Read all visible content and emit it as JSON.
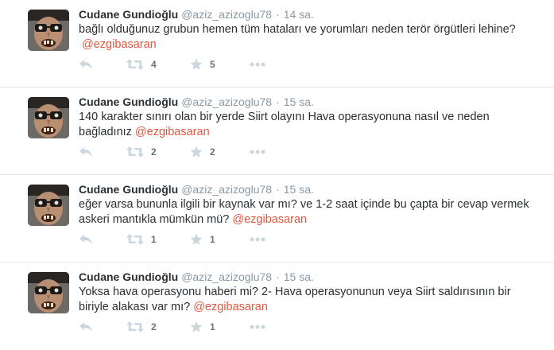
{
  "colors": {
    "mention": "#e0573f",
    "muted": "#8899a6",
    "icon": "#ccd6dd",
    "divider": "#e1e8ed"
  },
  "icons": {
    "reply": "reply-icon",
    "retweet": "retweet-icon",
    "favorite": "star-icon",
    "more": "more-icon"
  },
  "tweets": [
    {
      "fullname": "Cudane Gundioğlu",
      "username": "@aziz_azizoglu78",
      "separator": "·",
      "time": "14 sa.",
      "text": "bağlı olduğunuz grubun hemen tüm hataları ve yorumları neden terör örgütleri lehine?",
      "mention": "@ezgibasaran",
      "retweets": "4",
      "favorites": "5"
    },
    {
      "fullname": "Cudane Gundioğlu",
      "username": "@aziz_azizoglu78",
      "separator": "·",
      "time": "15 sa.",
      "text": "140 karakter sınırı olan bir yerde Siirt olayını Hava operasyonuna nasıl ve neden bağladınız",
      "mention": "@ezgibasaran",
      "retweets": "2",
      "favorites": "2"
    },
    {
      "fullname": "Cudane Gundioğlu",
      "username": "@aziz_azizoglu78",
      "separator": "·",
      "time": "15 sa.",
      "text": "eğer varsa bununla ilgili bir kaynak var mı? ve 1-2 saat içinde bu çapta bir cevap vermek askeri mantıkla mümkün mü?",
      "mention": "@ezgibasaran",
      "retweets": "1",
      "favorites": "1"
    },
    {
      "fullname": "Cudane Gundioğlu",
      "username": "@aziz_azizoglu78",
      "separator": "·",
      "time": "15 sa.",
      "text": "Yoksa hava operasyonu haberi mi? 2- Hava operasyonunun veya Siirt saldırısının bir biriyle alakası var mı?",
      "mention": "@ezgibasaran",
      "retweets": "2",
      "favorites": "1"
    }
  ]
}
